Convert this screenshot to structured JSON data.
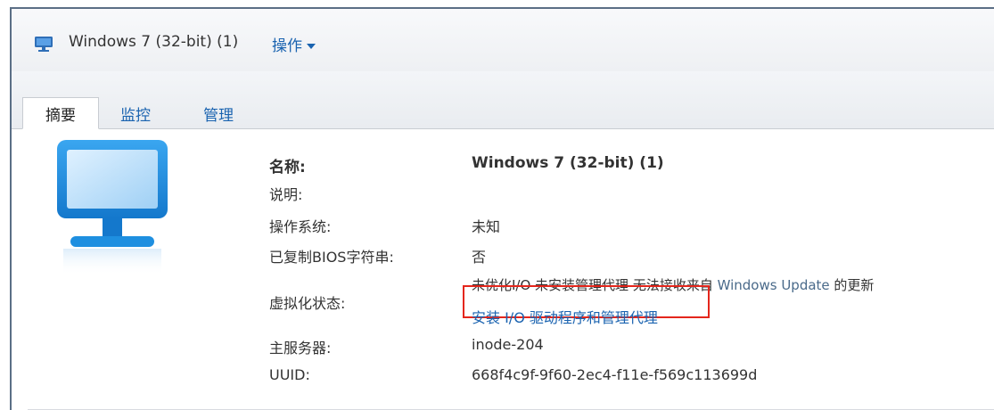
{
  "header": {
    "vm_title": "Windows 7 (32-bit) (1)",
    "action_label": "操作"
  },
  "tabs": [
    {
      "label": "摘要",
      "active": true
    },
    {
      "label": "监控",
      "active": false
    },
    {
      "label": "管理",
      "active": false
    }
  ],
  "summary": {
    "name_label": "名称:",
    "name_value": "Windows 7 (32-bit) (1)",
    "description_label": "说明:",
    "description_value": "",
    "os_label": "操作系统:",
    "os_value": "未知",
    "bios_label": "已复制BIOS字符串:",
    "bios_value": "否",
    "virt_label": "虚拟化状态:",
    "virt_status_part1": "未优化I/O 未安装管理代理 无法接收来自 ",
    "virt_status_part2": "Windows Update",
    "virt_status_part3": " 的更新",
    "install_link": "安装 I/O 驱动程序和管理代理",
    "host_label": "主服务器:",
    "host_value": "inode-204",
    "uuid_label": "UUID:",
    "uuid_value": "668f4c9f-9f60-2ec4-f11e-f569c113699d"
  },
  "colors": {
    "link": "#1a63b0",
    "highlight_box": "#e4261c",
    "monitor_blue": "#1e8fe0"
  }
}
